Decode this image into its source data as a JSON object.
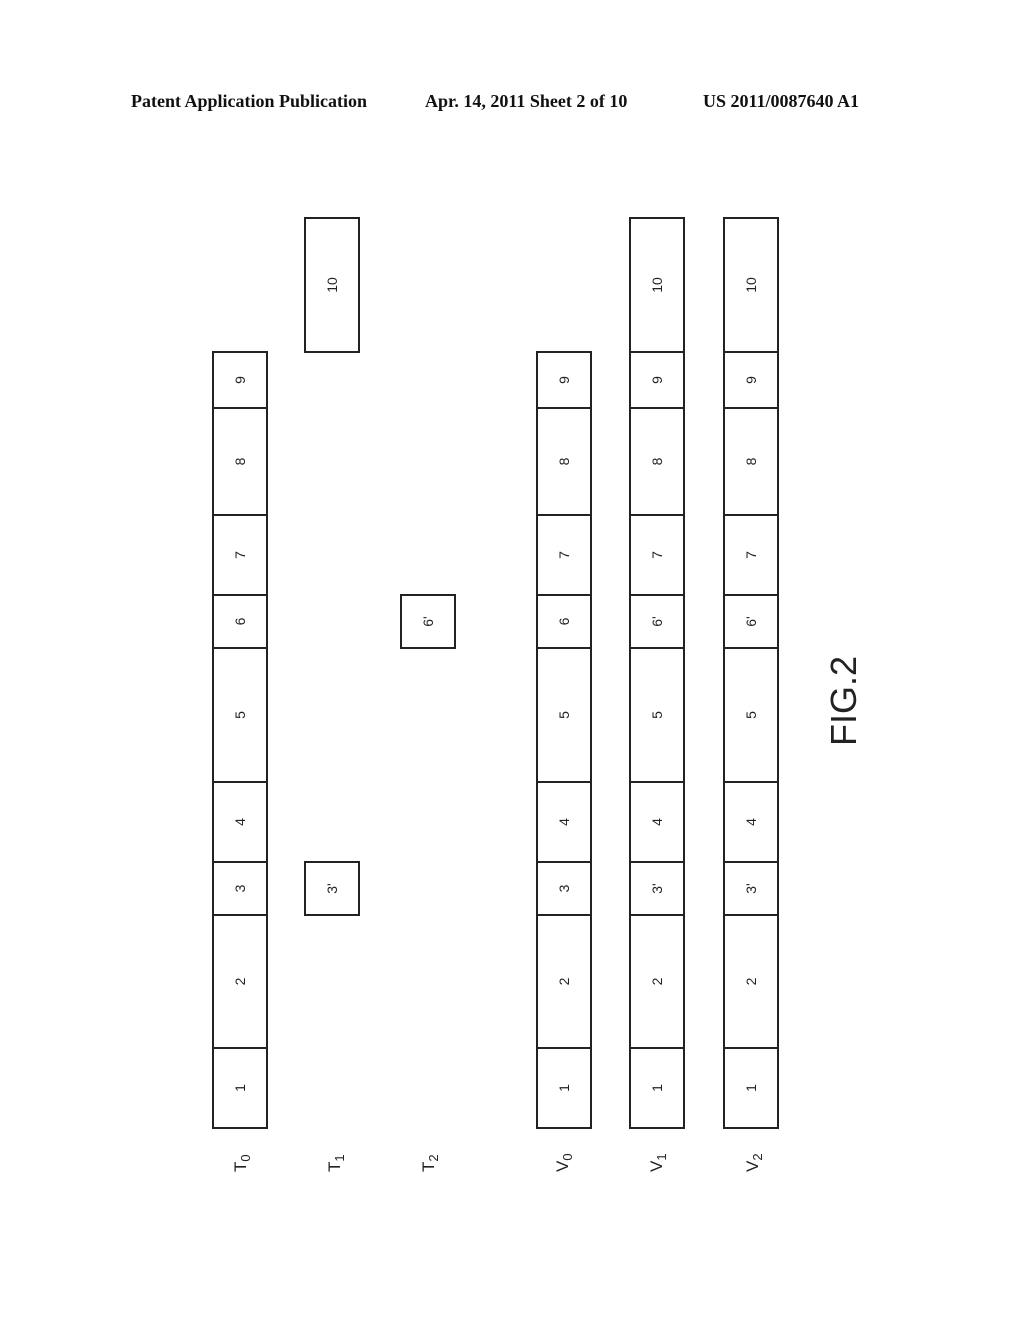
{
  "header": {
    "left": "Patent Application Publication",
    "middle": "Apr. 14, 2011  Sheet 2 of 10",
    "right": "US 2011/0087640 A1"
  },
  "figure_label": "FIG.2",
  "rows": [
    {
      "id": "T0",
      "label": "T",
      "sub": "0",
      "blocks": [
        {
          "label": "1",
          "hatched": false
        },
        {
          "label": "2",
          "hatched": false
        },
        {
          "label": "3",
          "hatched": false
        },
        {
          "label": "4",
          "hatched": false
        },
        {
          "label": "5",
          "hatched": false
        },
        {
          "label": "6",
          "hatched": false
        },
        {
          "label": "7",
          "hatched": false
        },
        {
          "label": "8",
          "hatched": false
        },
        {
          "label": "9",
          "hatched": false
        }
      ]
    },
    {
      "id": "T1",
      "label": "T",
      "sub": "1",
      "blocks": [
        {
          "label": "3'",
          "hatched": true,
          "replaces": "3"
        },
        {
          "label": "10",
          "hatched": true,
          "appended": true
        }
      ]
    },
    {
      "id": "T2",
      "label": "T",
      "sub": "2",
      "blocks": [
        {
          "label": "6'",
          "hatched": true,
          "replaces": "6"
        }
      ]
    },
    {
      "id": "V0",
      "label": "V",
      "sub": "0",
      "blocks": [
        {
          "label": "1",
          "hatched": false
        },
        {
          "label": "2",
          "hatched": false
        },
        {
          "label": "3",
          "hatched": false
        },
        {
          "label": "4",
          "hatched": false
        },
        {
          "label": "5",
          "hatched": false
        },
        {
          "label": "6",
          "hatched": false
        },
        {
          "label": "7",
          "hatched": false
        },
        {
          "label": "8",
          "hatched": false
        },
        {
          "label": "9",
          "hatched": false
        }
      ]
    },
    {
      "id": "V1",
      "label": "V",
      "sub": "1",
      "blocks": [
        {
          "label": "1",
          "hatched": false
        },
        {
          "label": "2",
          "hatched": false
        },
        {
          "label": "3'",
          "hatched": true
        },
        {
          "label": "4",
          "hatched": false
        },
        {
          "label": "5",
          "hatched": false
        },
        {
          "label": "6'",
          "hatched": false
        },
        {
          "label": "7",
          "hatched": false
        },
        {
          "label": "8",
          "hatched": false
        },
        {
          "label": "9",
          "hatched": false
        },
        {
          "label": "10",
          "hatched": true
        }
      ]
    },
    {
      "id": "V2",
      "label": "V",
      "sub": "2",
      "blocks": [
        {
          "label": "1",
          "hatched": false
        },
        {
          "label": "2",
          "hatched": false
        },
        {
          "label": "3'",
          "hatched": true
        },
        {
          "label": "4",
          "hatched": false
        },
        {
          "label": "5",
          "hatched": false
        },
        {
          "label": "6'",
          "hatched": true
        },
        {
          "label": "7",
          "hatched": false
        },
        {
          "label": "8",
          "hatched": false
        },
        {
          "label": "9",
          "hatched": false
        },
        {
          "label": "10",
          "hatched": true
        }
      ]
    }
  ]
}
